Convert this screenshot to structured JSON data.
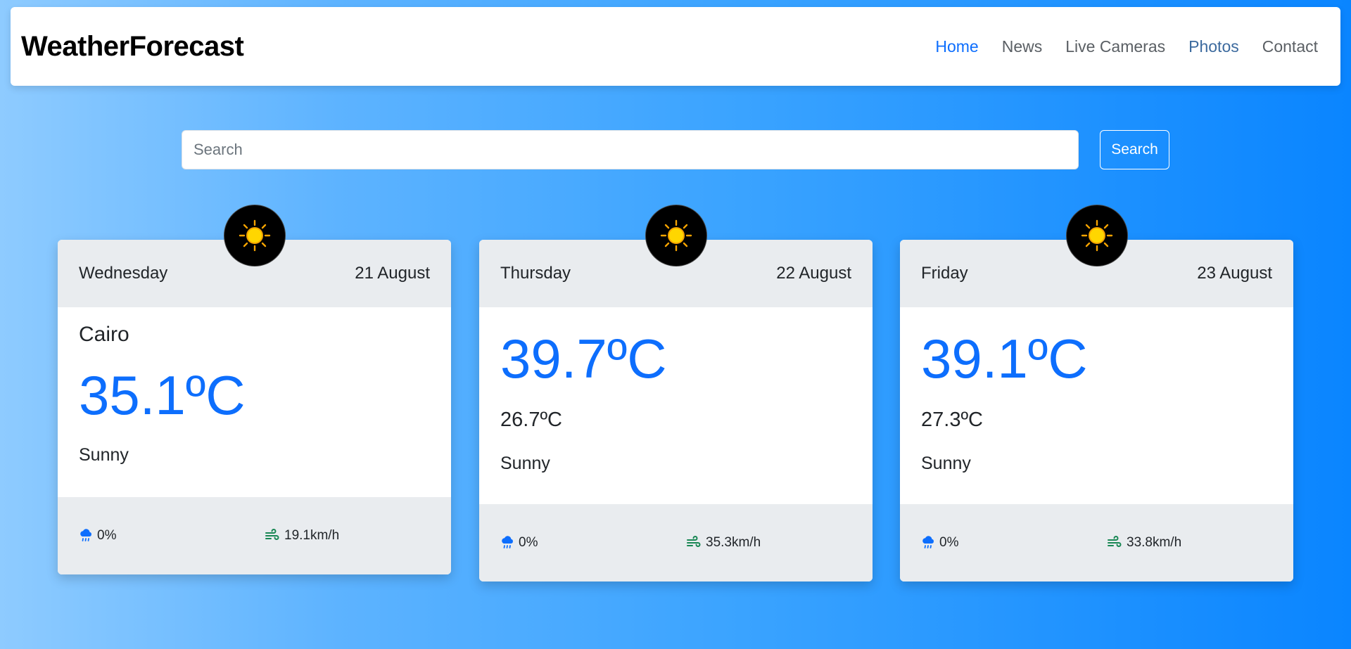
{
  "header": {
    "brand": "WeatherForecast",
    "nav": [
      "Home",
      "News",
      "Live Cameras",
      "Photos",
      "Contact"
    ]
  },
  "search": {
    "placeholder": "Search",
    "value": "",
    "button_label": "Search"
  },
  "colors": {
    "accent": "#0d6efd",
    "wind_icon": "#198754",
    "sun": "#f5c000"
  },
  "forecast": [
    {
      "day": "Wednesday",
      "date": "21 August",
      "city": "Cairo",
      "temp": "35.1ºC",
      "condition": "Sunny",
      "rain": "0%",
      "wind": "19.1km/h",
      "icon": "sun-icon"
    },
    {
      "day": "Thursday",
      "date": "22 August",
      "temp": "39.7ºC",
      "min_temp": "26.7ºC",
      "condition": "Sunny",
      "rain": "0%",
      "wind": "35.3km/h",
      "icon": "sun-icon"
    },
    {
      "day": "Friday",
      "date": "23 August",
      "temp": "39.1ºC",
      "min_temp": "27.3ºC",
      "condition": "Sunny",
      "rain": "0%",
      "wind": "33.8km/h",
      "icon": "sun-icon"
    }
  ]
}
